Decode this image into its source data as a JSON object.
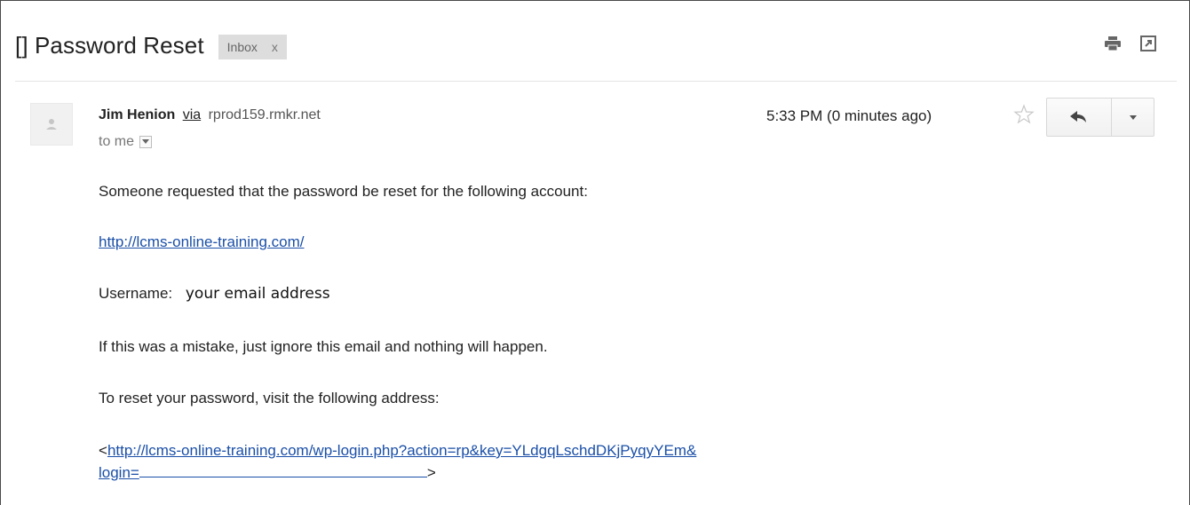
{
  "email": {
    "subject": "[] Password Reset",
    "label": "Inbox",
    "label_close": "x",
    "sender_name": "Jim Henion",
    "via": "via",
    "sender_domain": "rprod159.rmkr.net",
    "to": "to me",
    "time": "5:33 PM (0 minutes ago)",
    "body": {
      "line1": "Someone requested that the password be reset for the following account:",
      "site_link": "http://lcms-online-training.com/",
      "username_label": "Username:",
      "username_value": "your email address",
      "mistake": "If this was a mistake, just ignore this email and nothing will happen.",
      "reset_instruction": "To reset your password, visit the following address:",
      "reset_open": "<",
      "reset_link_part1": "http://lcms-online-training.com/wp-login.php?action=rp&key=YLdgqLschdDKjPyqyYEm&",
      "reset_link_part2": "login=",
      "reset_close": ">"
    }
  },
  "icons": {
    "print": "print-icon",
    "popout": "new-window-icon",
    "avatar": "person-icon",
    "star": "star-icon",
    "reply": "reply-icon",
    "more": "caret-down-icon"
  },
  "colors": {
    "link": "#1a4fa8",
    "label_bg": "#dddddd"
  }
}
